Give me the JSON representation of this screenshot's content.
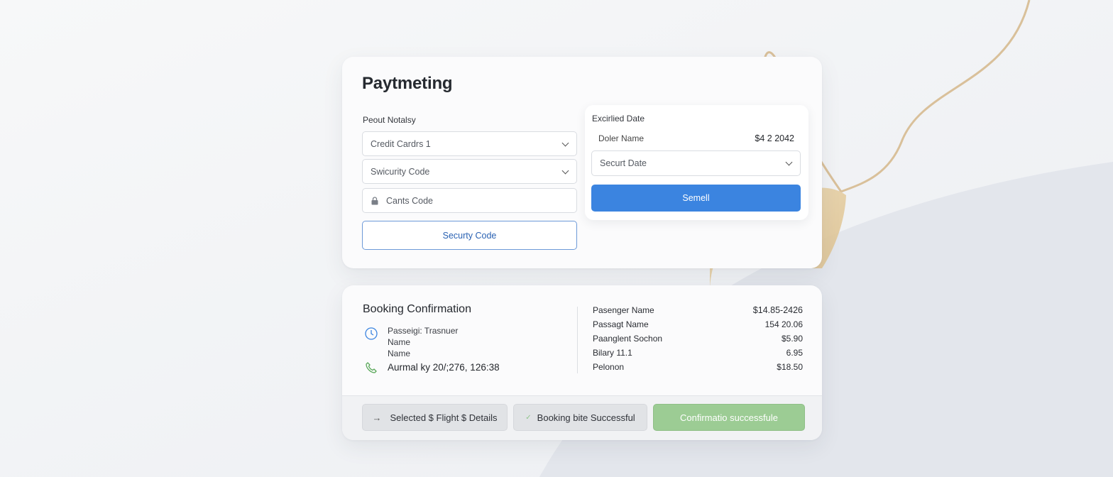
{
  "payment": {
    "title": "Paytmeting",
    "left_label": "Peout Notalsy",
    "select_card": "Credit Cardrs 1",
    "select_security": "Swicurity Code",
    "input_code": "Cants Code",
    "outline_button": "Securty Code"
  },
  "sub": {
    "label": "Excirlied Date",
    "name_label": "Doler Name",
    "name_value": "$4 2 2042",
    "select_date": "Securt Date",
    "submit": "Semell"
  },
  "booking": {
    "title": "Booking Confirmation",
    "line1": "Passeigi: Trasnuer",
    "line2": "Name",
    "line3": "Name",
    "line4": "Aurmal ky 20/;276, 126:38",
    "rows": [
      {
        "label": "Pasenger Name",
        "value": "$14.85-2426"
      },
      {
        "label": "Passagt Name",
        "value": "154 20.06"
      },
      {
        "label": "Paanglent Sochon",
        "value": "$5.90"
      },
      {
        "label": "Bilary 11.1",
        "value": "6.95"
      },
      {
        "label": "Pelonon",
        "value": "$18.50"
      }
    ]
  },
  "footer": {
    "btn1": "Selected $ Flight $ Details",
    "btn2": "Booking bite Successful",
    "btn3": "Confirmatio successfule"
  },
  "colors": {
    "primary": "#3b84e0",
    "success": "#9ccc94",
    "accent_tan": "#e6cfa4"
  }
}
